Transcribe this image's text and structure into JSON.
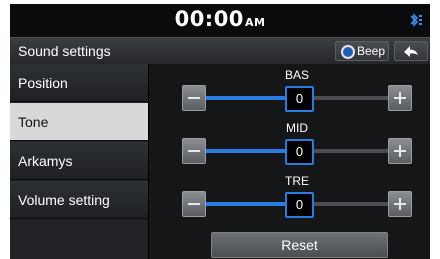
{
  "status_bar": {
    "time": "00:00",
    "ampm": "AM"
  },
  "header": {
    "title": "Sound settings",
    "beep_label": "Beep"
  },
  "sidebar": {
    "items": [
      {
        "label": "Position",
        "active": false
      },
      {
        "label": "Tone",
        "active": true
      },
      {
        "label": "Arkamys",
        "active": false
      },
      {
        "label": "Volume setting",
        "active": false
      }
    ]
  },
  "tone": {
    "bass": {
      "label": "BAS",
      "value": "0"
    },
    "mid": {
      "label": "MID",
      "value": "0"
    },
    "treble": {
      "label": "TRE",
      "value": "0"
    }
  },
  "reset_label": "Reset",
  "colors": {
    "accent": "#2a7be0",
    "active_tab": "#d8d8d8"
  }
}
